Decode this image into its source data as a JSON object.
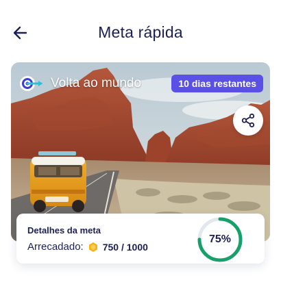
{
  "header": {
    "title": "Meta rápida",
    "back_icon": "arrow-left-icon"
  },
  "goal": {
    "name": "Volta ao mundo",
    "icon": "target-arrow-icon",
    "days_remaining_label": "10 dias restantes",
    "share_icon": "share-icon",
    "image": "desert road with vintage yellow van and red rock formations"
  },
  "details": {
    "title": "Detalhes da meta",
    "raised_label": "Arrecadado:",
    "coin_icon": "coin-icon",
    "raised_value": "750 / 1000",
    "progress_label": "75%",
    "progress_fraction": 0.75
  },
  "colors": {
    "primary_dark": "#1b1f55",
    "badge_purple": "#5b50e6",
    "progress_green": "#17a06a",
    "progress_track": "#e3e7ee",
    "coin_gold": "#f4b41a"
  }
}
